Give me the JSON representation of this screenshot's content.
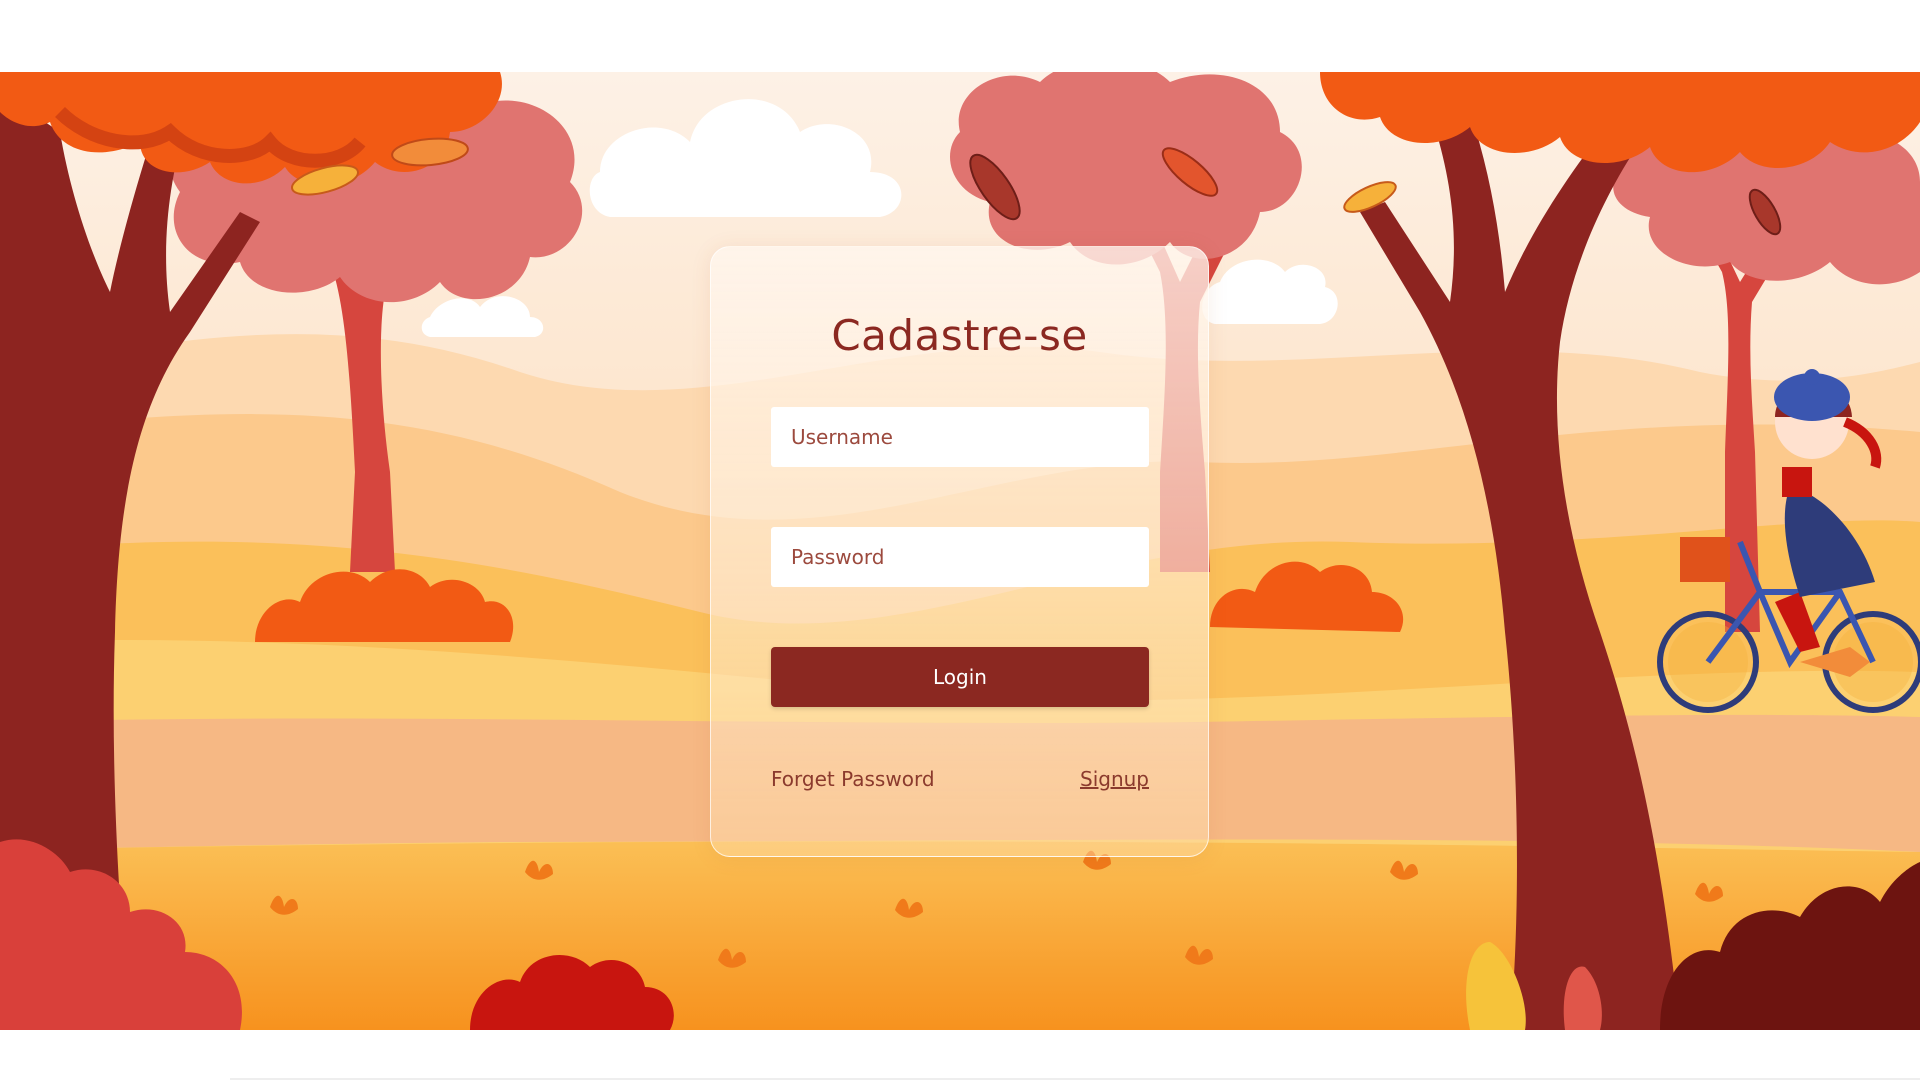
{
  "form": {
    "title": "Cadastre-se",
    "username_placeholder": "Username",
    "password_placeholder": "Password",
    "login_label": "Login",
    "forget_password_label": "Forget Password",
    "signup_label": "Signup"
  },
  "colors": {
    "primary": "#8b2821",
    "sky": "#fde6cf",
    "ground": "#f9a53a",
    "trunk_dark": "#8d2420",
    "trunk_light": "#d8473e",
    "foliage_orange": "#f25a14",
    "foliage_pink": "#e07470"
  },
  "scene": {
    "illustration": "autumn-park-background",
    "character": "girl-riding-bicycle"
  }
}
